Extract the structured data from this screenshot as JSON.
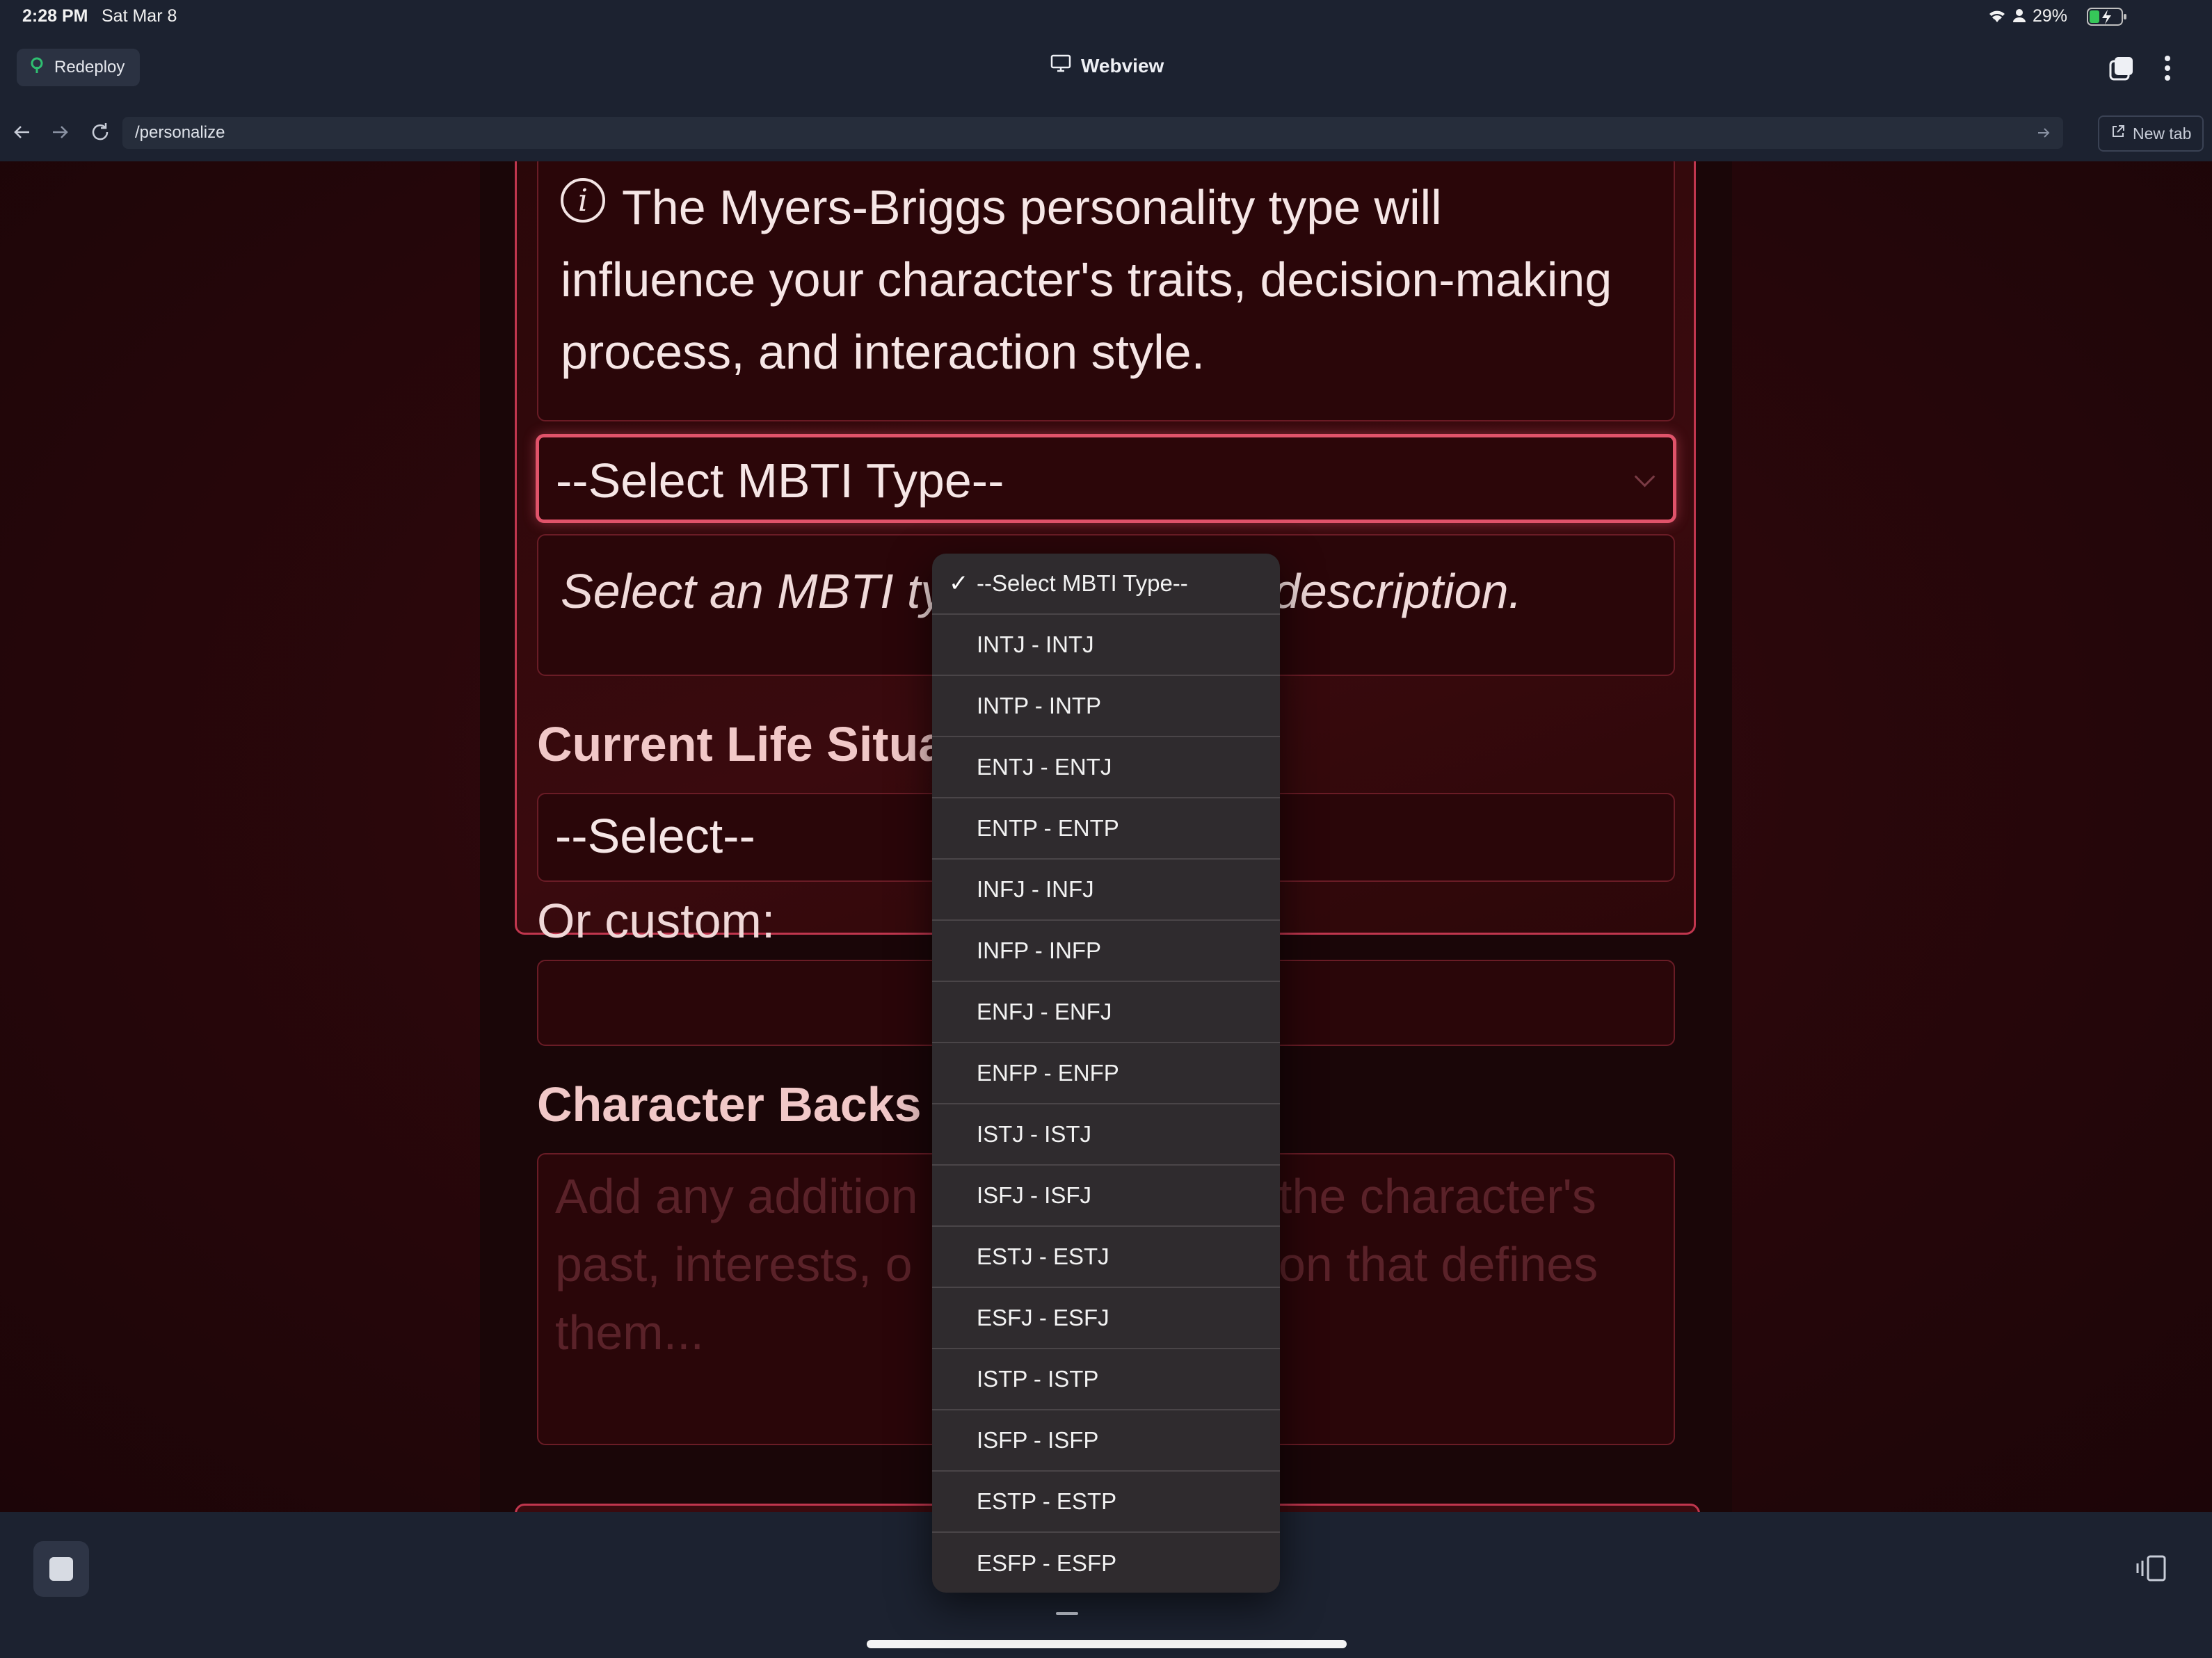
{
  "status_bar": {
    "time": "2:28 PM",
    "date": "Sat Mar 8",
    "battery": "29%"
  },
  "toolbar": {
    "redeploy_label": "Redeploy",
    "title": "Webview"
  },
  "address_bar": {
    "url": "/personalize",
    "new_tab_label": "New tab"
  },
  "form": {
    "info_text": "The Myers-Briggs personality type will influence your character's traits, decision-making process, and interaction style.",
    "mbti_select_value": "--Select MBTI Type--",
    "mbti_description_visible": "Select an MBTI ty",
    "mbti_description_tail": "description.",
    "life_situation_heading": "Current Life Situa",
    "life_select_value": "--Select--",
    "custom_label": "Or custom:",
    "backstory_heading": "Character Backs",
    "backstory_placeholder_line1_a": "Add any addition",
    "backstory_placeholder_line1_b": "the character's",
    "backstory_placeholder_line2_a": "past, interests, o",
    "backstory_placeholder_line2_b": "on that defines",
    "backstory_placeholder_line3": "them..."
  },
  "dropdown": {
    "options": [
      "--Select MBTI Type--",
      "INTJ - INTJ",
      "INTP - INTP",
      "ENTJ - ENTJ",
      "ENTP - ENTP",
      "INFJ - INFJ",
      "INFP - INFP",
      "ENFJ - ENFJ",
      "ENFP - ENFP",
      "ISTJ - ISTJ",
      "ISFJ - ISFJ",
      "ESTJ - ESTJ",
      "ESFJ - ESFJ",
      "ISTP - ISTP",
      "ISFP - ISFP",
      "ESTP - ESTP",
      "ESFP - ESFP"
    ],
    "selected_index": 0
  },
  "colors": {
    "accent": "#e0536a",
    "card_border": "#c0364e",
    "background": "#2a070b"
  }
}
